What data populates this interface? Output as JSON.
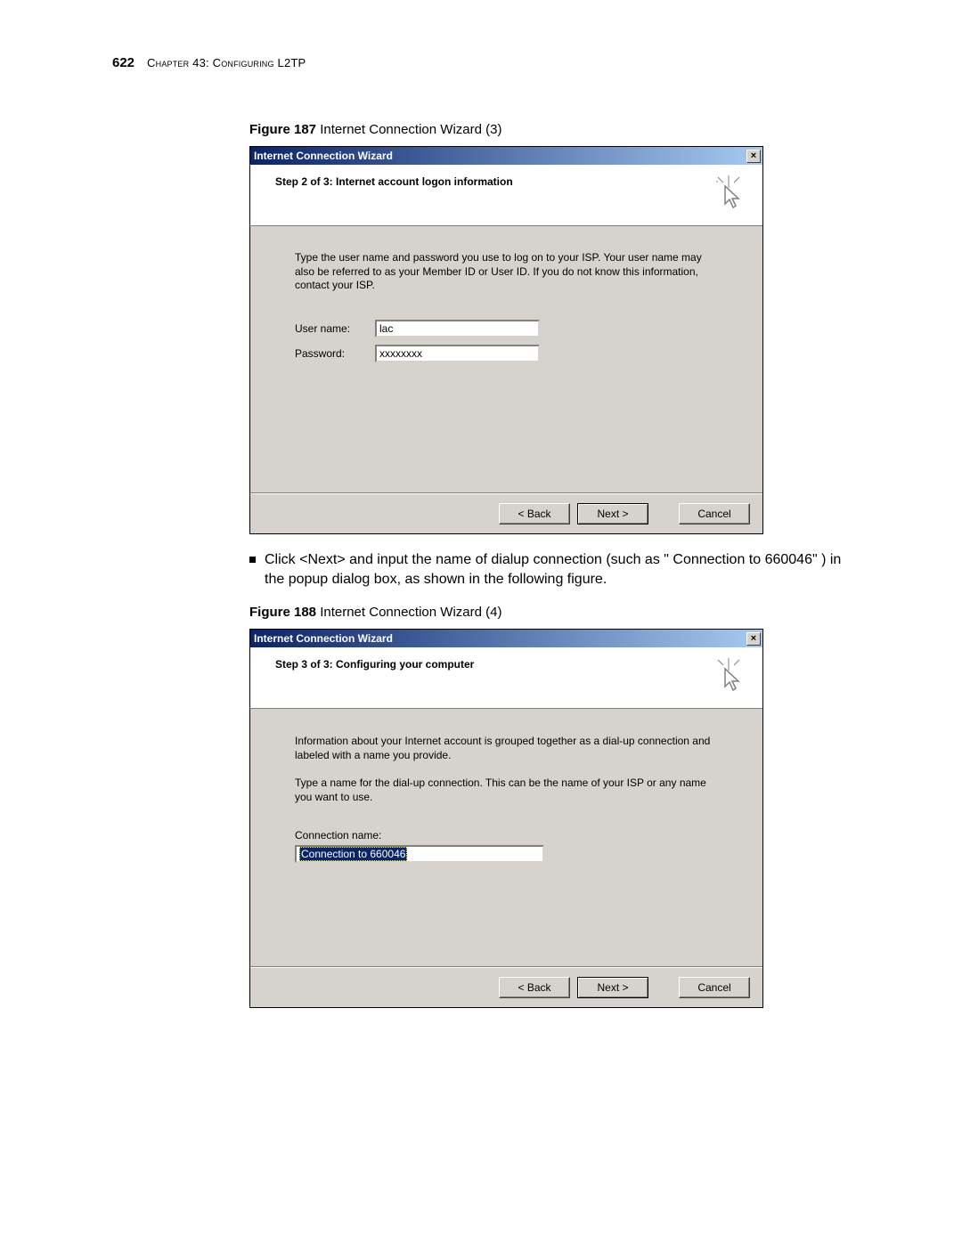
{
  "header": {
    "pageNumber": "622",
    "chapter": "Chapter 43: Configuring L2TP"
  },
  "figure187": {
    "caption_bold": "Figure 187",
    "caption_rest": "   Internet Connection Wizard (3)",
    "dialog": {
      "title": "Internet Connection Wizard",
      "close": "×",
      "step": "Step 2 of 3: Internet account logon information",
      "instructions": "Type the user name and password you use to log on to your ISP. Your user name may also be referred to as your Member ID or User ID. If you do not know this information, contact your ISP.",
      "username_label": "User name:",
      "username_value": "lac",
      "password_label": "Password:",
      "password_value": "xxxxxxxx",
      "buttons": {
        "back": "< Back",
        "next": "Next >",
        "cancel": "Cancel"
      }
    }
  },
  "bulletText": "Click <Next> and input the name of dialup connection (such as \" Connection to 660046\" ) in the popup dialog box, as shown in the following figure.",
  "figure188": {
    "caption_bold": "Figure 188",
    "caption_rest": "   Internet Connection Wizard (4)",
    "dialog": {
      "title": "Internet Connection Wizard",
      "close": "×",
      "step": "Step 3 of 3: Configuring your computer",
      "instructions1": "Information about your Internet account is grouped together as a dial-up connection and labeled with a name you provide.",
      "instructions2": "Type a name for the dial-up connection. This can be the name of your ISP or any name you want to use.",
      "conn_label": "Connection name:",
      "conn_value": "Connection to 660046",
      "buttons": {
        "back": "< Back",
        "next": "Next >",
        "cancel": "Cancel"
      }
    }
  }
}
